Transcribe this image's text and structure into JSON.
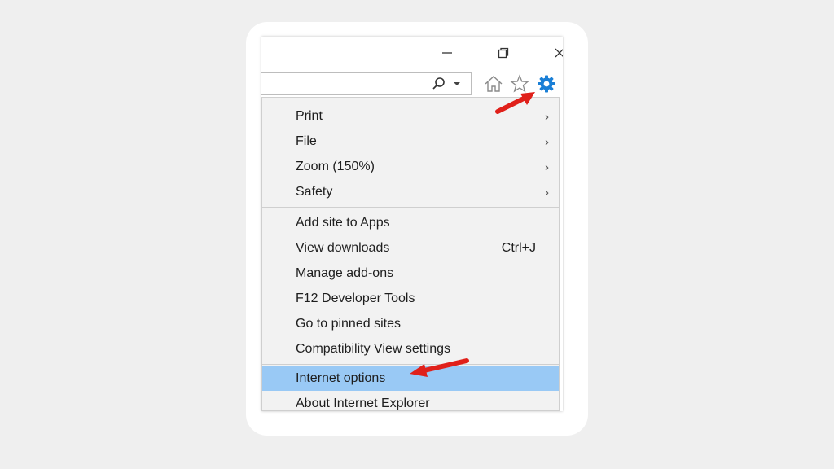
{
  "window": {
    "minimize_icon": "minimize-icon",
    "restore_icon": "restore-icon",
    "close_icon": "close-icon"
  },
  "toolbar": {
    "search_icon": "search-icon",
    "dropdown_icon": "chevron-down-icon",
    "home_icon": "home-icon",
    "favorites_icon": "star-icon",
    "tools_icon": "gear-icon",
    "tools_color": "#1a7fd6"
  },
  "menu": {
    "items": [
      {
        "label": "Print",
        "submenu": true
      },
      {
        "label": "File",
        "submenu": true
      },
      {
        "label": "Zoom (150%)",
        "submenu": true
      },
      {
        "label": "Safety",
        "submenu": true
      },
      {
        "label": "Add site to Apps"
      },
      {
        "label": "View downloads",
        "shortcut": "Ctrl+J"
      },
      {
        "label": "Manage add-ons"
      },
      {
        "label": "F12 Developer Tools"
      },
      {
        "label": "Go to pinned sites"
      },
      {
        "label": "Compatibility View settings"
      },
      {
        "label": "Internet options",
        "highlighted": true
      },
      {
        "label": "About Internet Explorer"
      }
    ],
    "highlight_color": "#99c9f5"
  },
  "annotations": {
    "arrow_color": "#e0201a"
  }
}
